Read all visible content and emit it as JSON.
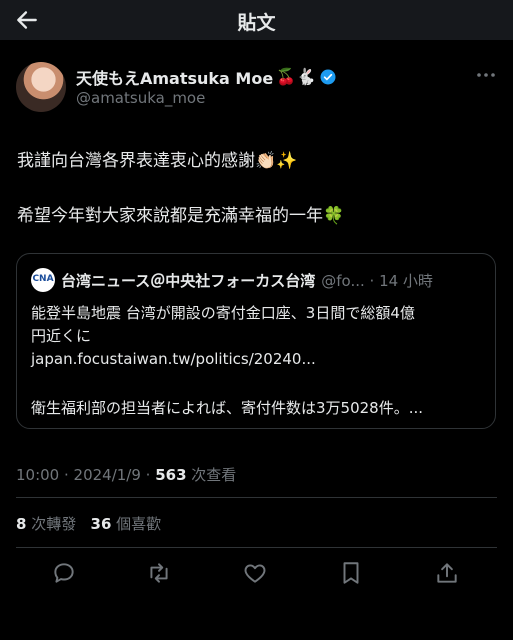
{
  "header": {
    "title": "貼文"
  },
  "author": {
    "name": "天使もえAmatsuka Moe",
    "emojis": "🍒🐇",
    "handle": "@amatsuka_moe"
  },
  "tweet": {
    "line1": "我謹向台灣各界表達衷心的感謝👏🏻✨",
    "line2": "希望今年對大家來說都是充滿幸福的一年🍀"
  },
  "quote": {
    "logo_text": "CNA",
    "name": "台湾ニュース＠中央社フォーカス台湾",
    "handle_time": "@fo... · 14 小時",
    "line1": "能登半島地震 台湾が開設の寄付金口座、3日間で総額4億",
    "line2": "円近くに",
    "link": "japan.focustaiwan.tw/politics/20240...",
    "line4": "衛生福利部の担当者によれば、寄付件数は3万5028件。..."
  },
  "meta": {
    "time_date": "10:00 · 2024/1/9 · ",
    "views_count": "563",
    "views_label": " 次查看"
  },
  "stats": {
    "retweets": "8",
    "retweets_label": " 次轉發",
    "likes": "36",
    "likes_label": " 個喜歡"
  },
  "colors": {
    "accent": "#1d9bf0",
    "text": "#e7e9ea",
    "muted": "#71767b",
    "border": "#2f3336"
  },
  "icons": [
    "back-arrow-icon",
    "verified-badge-icon",
    "more-options-icon",
    "reply-icon",
    "retweet-icon",
    "like-icon",
    "bookmark-icon",
    "share-icon"
  ]
}
